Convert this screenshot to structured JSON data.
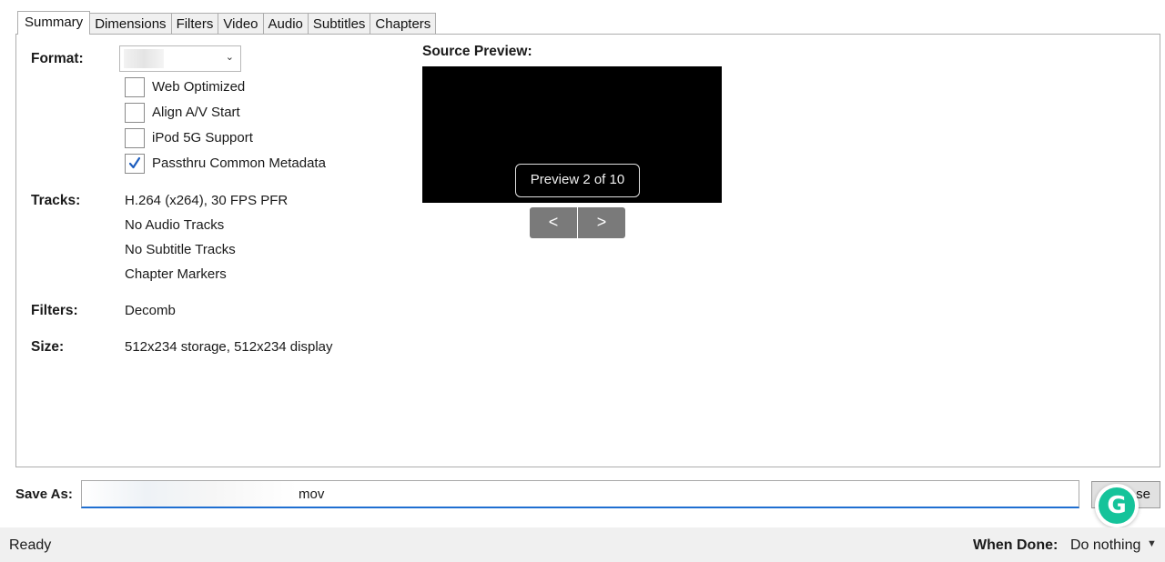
{
  "tabs": [
    "Summary",
    "Dimensions",
    "Filters",
    "Video",
    "Audio",
    "Subtitles",
    "Chapters"
  ],
  "active_tab": "Summary",
  "summary": {
    "format_label": "Format:",
    "format_value": "",
    "checkboxes": [
      {
        "label": "Web Optimized",
        "checked": false
      },
      {
        "label": "Align A/V Start",
        "checked": false
      },
      {
        "label": "iPod 5G Support",
        "checked": false
      },
      {
        "label": "Passthru Common Metadata",
        "checked": true
      }
    ],
    "tracks_label": "Tracks:",
    "tracks": [
      "H.264 (x264), 30 FPS PFR",
      "No Audio Tracks",
      "No Subtitle Tracks",
      "Chapter Markers"
    ],
    "filters_label": "Filters:",
    "filters_value": "Decomb",
    "size_label": "Size:",
    "size_value": "512x234 storage, 512x234 display"
  },
  "preview": {
    "title": "Source Preview:",
    "badge": "Preview 2 of 10",
    "prev_label": "<",
    "next_label": ">"
  },
  "save_as": {
    "label": "Save As:",
    "value_visible": "mov",
    "browse_label_visible": "se"
  },
  "grammarly": {
    "letter": "G"
  },
  "status": {
    "ready": "Ready",
    "when_done_label": "When Done:",
    "when_done_value": "Do nothing"
  },
  "colors": {
    "checkmark": "#1f5fbf",
    "preview_bg": "#000000",
    "nav_button": "#7a7a7a",
    "grammarly": "#15c39a",
    "input_focus": "#1f6fd1"
  }
}
